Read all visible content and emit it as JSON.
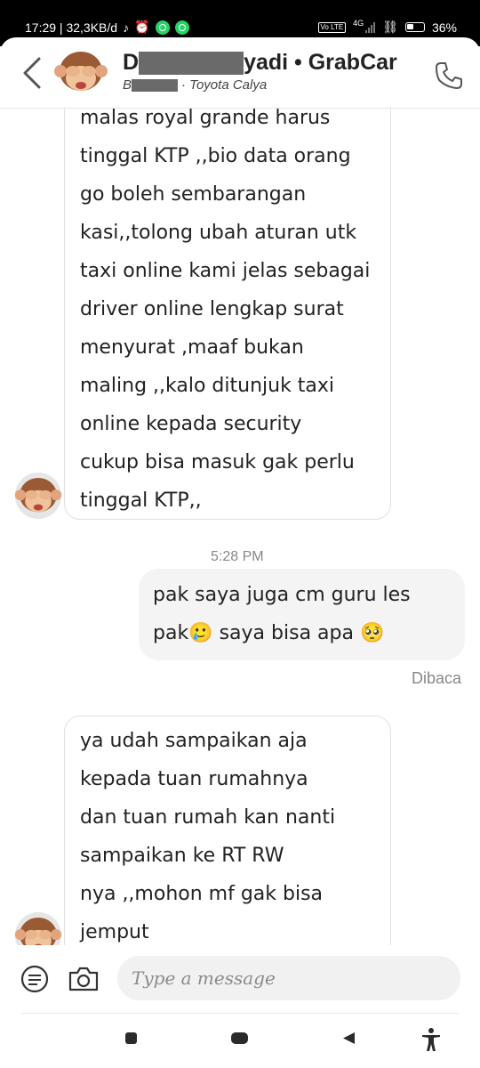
{
  "status_bar": {
    "left_text": "17:29 | 32,3KB/d",
    "network": "4G",
    "volte": "Vo LTE",
    "battery": "36%",
    "icons": [
      "music-note-icon",
      "alarm-icon",
      "whatsapp-icon",
      "whatsapp-icon",
      "link-icon",
      "toggle-icon",
      "battery-icon"
    ]
  },
  "header": {
    "name_start": "D",
    "name_end": "yadi • GrabCar",
    "sub_start": "B",
    "sub_end": "· Toyota Calya"
  },
  "messages": {
    "incoming_1": [
      "malas royal grande harus",
      "tinggal KTP ,,bio data orang",
      "go boleh sembarangan",
      "kasi,,tolong ubah aturan utk",
      "taxi online kami jelas sebagai",
      "driver online lengkap surat",
      "menyurat ,maaf bukan",
      "maling ,,kalo ditunjuk taxi",
      "online kepada security",
      "cukup bisa masuk gak perlu",
      "tinggal KTP,,"
    ],
    "timestamp": "5:28 PM",
    "outgoing_1_line1": "pak saya juga cm guru les",
    "outgoing_1_line2_a": "pak",
    "outgoing_1_emoji_a": "🥲",
    "outgoing_1_line2_b": " saya bisa apa ",
    "outgoing_1_emoji_b": "🥺",
    "read_status": "Dibaca",
    "incoming_2": [
      "ya udah sampaikan aja",
      "kepada tuan rumahnya",
      "dan tuan rumah kan nanti",
      "sampaikan ke RT RW",
      "nya ,,mohon mf gak bisa",
      "jemput"
    ]
  },
  "composer": {
    "placeholder": "Type a message"
  }
}
